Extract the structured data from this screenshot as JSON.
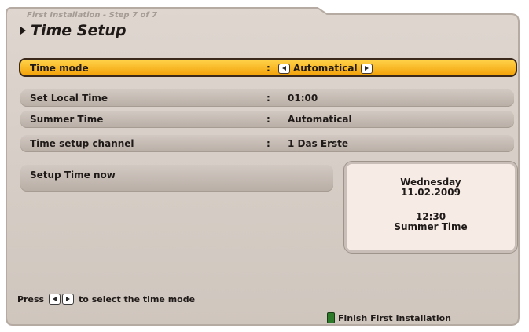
{
  "header": {
    "step": "First Installation - Step 7 of 7",
    "title": "Time Setup"
  },
  "menu": {
    "rows": [
      {
        "label": "Time mode",
        "value": "Automatical",
        "selected": true
      },
      {
        "label": "Set Local Time",
        "value": "01:00"
      },
      {
        "label": "Summer Time",
        "value": "Automatical"
      },
      {
        "label": "Time setup channel",
        "value": "1 Das Erste"
      },
      {
        "label": "Setup Time now"
      }
    ],
    "separator": ":"
  },
  "info": {
    "day": "Wednesday",
    "date": "11.02.2009",
    "time": "12:30",
    "mode": "Summer Time"
  },
  "footer": {
    "hint_prefix": "Press",
    "hint_suffix": "to select the time mode",
    "finish_label": "Finish First Installation",
    "finish_color": "#2d7a2a"
  },
  "colors": {
    "panel": "#d8d0c8",
    "row": "#c5bbb3",
    "selected_row": "#f7b420",
    "infobox": "#f6ebe5"
  }
}
